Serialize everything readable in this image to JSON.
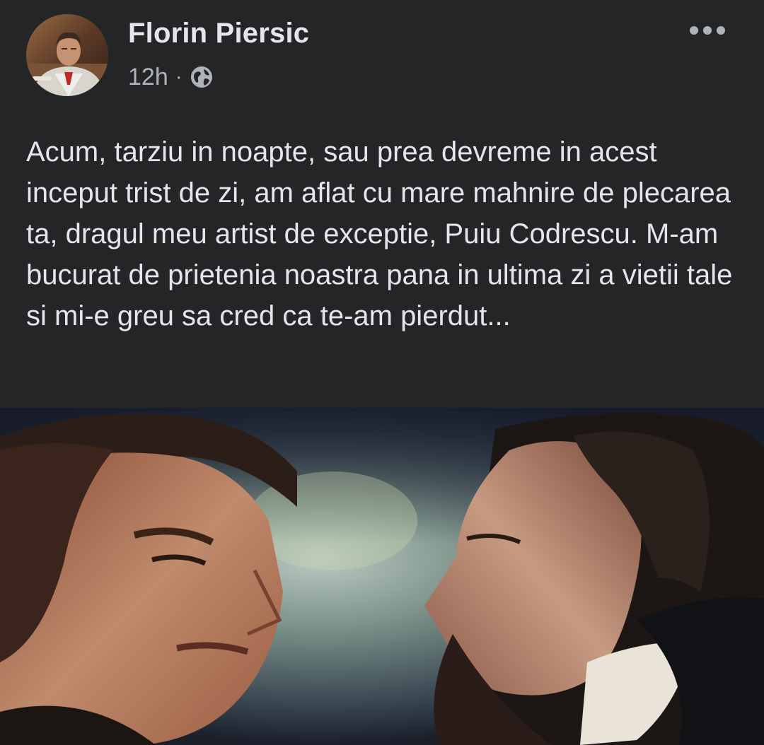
{
  "post": {
    "author": "Florin Piersic",
    "time": "12h",
    "separator": "·",
    "privacy_icon": "globe-icon",
    "more_icon": "more-horizontal-icon",
    "text": "Acum, tarziu in noapte, sau prea devreme in acest inceput trist de zi, am aflat cu mare mahnire de plecarea ta, dragul meu artist de exceptie, Puiu Codrescu. M-am bucurat  de prietenia noastra pana in ultima zi a vietii tale si mi-e greu sa cred ca te-am pierdut...",
    "photo_subject": "movie-still-two-men-face-to-face"
  },
  "colors": {
    "background": "#242526",
    "primary_text": "#e4e6eb",
    "secondary_text": "#b0b3b8"
  }
}
